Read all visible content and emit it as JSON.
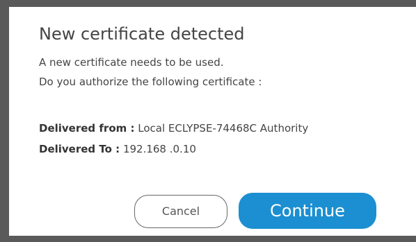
{
  "dialog": {
    "title": "New certificate detected",
    "message_line1": "A new certificate needs to be used.",
    "message_line2": "Do you authorize the following certificate :",
    "delivered_from_label": "Delivered from :",
    "delivered_from_value": "Local ECLYPSE-74468C Authority",
    "delivered_to_label": "Delivered To :",
    "delivered_to_value": "192.168 .0.10",
    "cancel_label": "Cancel",
    "continue_label": "Continue"
  },
  "colors": {
    "backdrop": "#5a5a5a",
    "dialog_background": "#ffffff",
    "primary_button": "#1b8fd1",
    "text": "#444444"
  }
}
